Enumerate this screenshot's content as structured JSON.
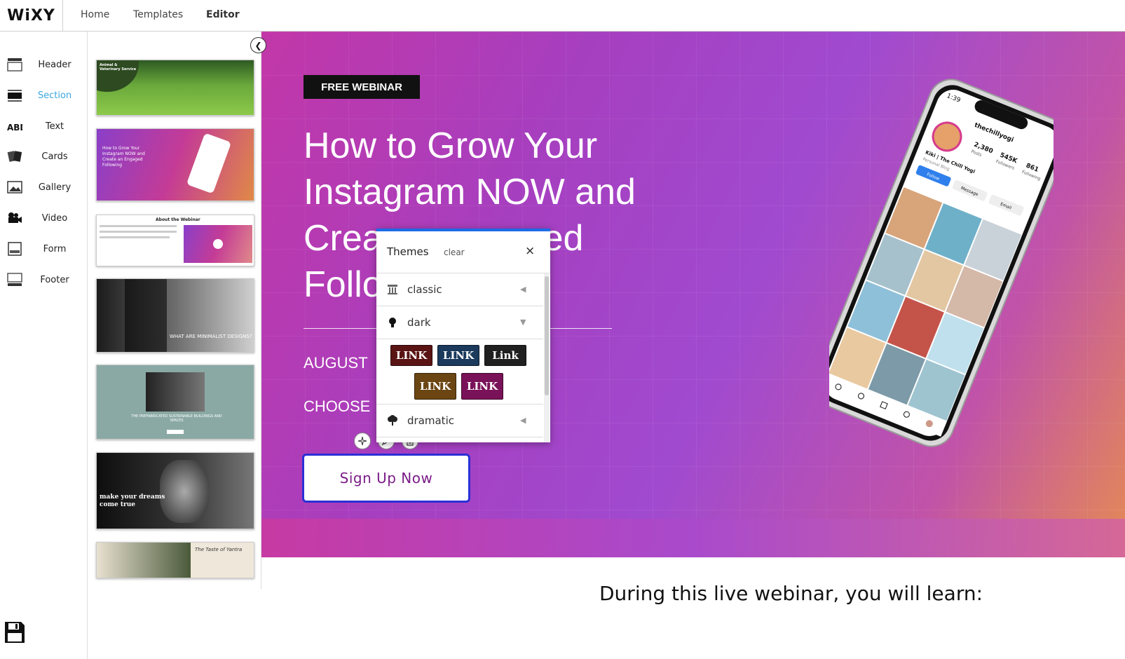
{
  "app": {
    "logo": "WiXY"
  },
  "nav": {
    "items": [
      "Home",
      "Templates",
      "Editor"
    ],
    "active": "Editor"
  },
  "tools": [
    {
      "label": "Header",
      "icon": "header-icon"
    },
    {
      "label": "Section",
      "icon": "section-icon",
      "active": true
    },
    {
      "label": "Text",
      "icon": "text-icon"
    },
    {
      "label": "Cards",
      "icon": "cards-icon"
    },
    {
      "label": "Gallery",
      "icon": "gallery-icon"
    },
    {
      "label": "Video",
      "icon": "video-icon"
    },
    {
      "label": "Form",
      "icon": "form-icon"
    },
    {
      "label": "Footer",
      "icon": "footer-icon"
    }
  ],
  "thumbnails": {
    "t1": "Animal & Veterinary Service",
    "t2": "How to Grow Your Instagram NOW and Create an Engaged Following",
    "t3": "About the Webinar",
    "t4": "WHAT ARE MINIMALIST DESIGNS?",
    "t5": "THE PREFABRICATED SUSTAINABLE BUILDINGS AND SPACES",
    "t6": "make your dreams come true",
    "t7": "The Taste of Yantra"
  },
  "hero": {
    "badge": "FREE WEBINAR",
    "headline_1": "How to Grow Your",
    "headline_2": "Instagram NOW and",
    "headline_3": "Crea",
    "headline_3b": "ged",
    "headline_4": "Follo",
    "date": "AUGUST",
    "choose": "CHOOSE",
    "cta": "Sign Up Now"
  },
  "section2": {
    "subhead": "During this live webinar, you will learn:"
  },
  "themes_popup": {
    "title": "Themes",
    "clear": "clear",
    "close": "×",
    "rows": [
      {
        "label": "classic",
        "icon": "column-icon",
        "state": "collapsed"
      },
      {
        "label": "dark",
        "icon": "lightbulb-icon",
        "state": "expanded"
      },
      {
        "label": "dramatic",
        "icon": "tree-icon",
        "state": "collapsed"
      }
    ],
    "swatches": [
      {
        "label": "LINK",
        "bg": "#5a1414"
      },
      {
        "label": "LINK",
        "bg": "#1b3a5c"
      },
      {
        "label": "Link",
        "bg": "#202020"
      },
      {
        "label": "LINK",
        "bg": "#6b4512"
      },
      {
        "label": "LINK",
        "bg": "#7a1259"
      }
    ]
  },
  "phone": {
    "username": "thechillyogi",
    "posts": "2,380",
    "followers": "545K",
    "following": "861",
    "posts_label": "Posts",
    "followers_label": "Followers",
    "following_label": "Following",
    "name": "Kiki | The Chill Yogi",
    "bio": "Personal Blog",
    "follow": "Follow",
    "message": "Message",
    "email": "Email",
    "time": "1:39"
  },
  "colors": {
    "accent": "#1e6be6",
    "active_tool": "#3aa7e0",
    "cta_border": "#2b2fd6",
    "cta_text": "#7a1d86"
  }
}
